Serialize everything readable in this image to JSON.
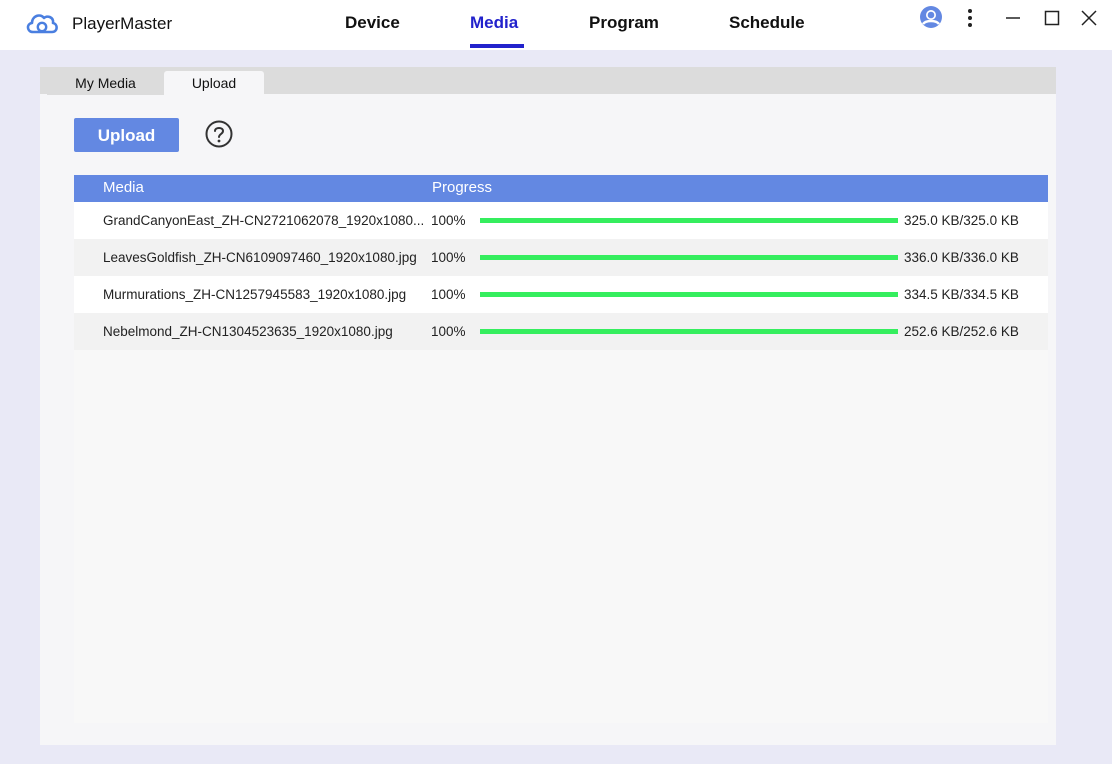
{
  "app": {
    "name": "PlayerMaster"
  },
  "nav": {
    "tabs": [
      {
        "label": "Device"
      },
      {
        "label": "Media"
      },
      {
        "label": "Program"
      },
      {
        "label": "Schedule"
      }
    ],
    "active": "Media"
  },
  "subtabs": [
    {
      "label": "My Media"
    },
    {
      "label": "Upload"
    }
  ],
  "toolbar": {
    "upload_label": "Upload"
  },
  "table": {
    "headers": {
      "media": "Media",
      "progress": "Progress"
    },
    "rows": [
      {
        "name": "GrandCanyonEast_ZH-CN2721062078_1920x1080...",
        "percent_text": "100%",
        "progress": 1.0,
        "size": "325.0 KB/325.0 KB"
      },
      {
        "name": "LeavesGoldfish_ZH-CN6109097460_1920x1080.jpg",
        "percent_text": "100%",
        "progress": 1.0,
        "size": "336.0 KB/336.0 KB"
      },
      {
        "name": "Murmurations_ZH-CN1257945583_1920x1080.jpg",
        "percent_text": "100%",
        "progress": 1.0,
        "size": "334.5 KB/334.5 KB"
      },
      {
        "name": "Nebelmond_ZH-CN1304523635_1920x1080.jpg",
        "percent_text": "100%",
        "progress": 1.0,
        "size": "252.6 KB/252.6 KB"
      }
    ]
  },
  "colors": {
    "accent": "#6388e2",
    "active_nav": "#2222cc",
    "progress": "#35ee5e"
  },
  "icons": {
    "logo": "cloud-logo-icon",
    "user": "user-avatar-icon",
    "more": "more-vertical-icon",
    "minimize": "minimize-icon",
    "maximize": "maximize-icon",
    "close": "close-icon",
    "help": "help-icon"
  }
}
